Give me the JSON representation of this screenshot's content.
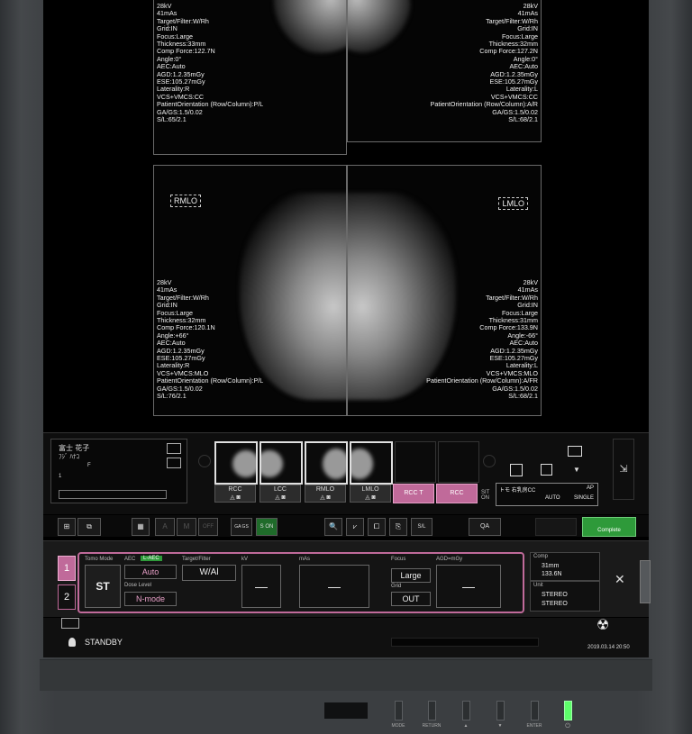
{
  "images": {
    "rcc_overlay": "28kV\n41mAs\nTarget/Filter:W/Rh\nGrid:IN\nFocus:Large\nThickness:33mm\nComp Force:122.7N\nAngle:0°\nAEC:Auto\nAGD:1.2.35mGy\nESE:105.27mGy\nLaterality:R\nVCS+VMCS:CC\nPatientOrientation (Row/Column):P/L\nGA/GS:1.5/0.02\nS/L:65/2.1",
    "lcc_overlay": "28kV\n41mAs\nTarget/Filter:W/Rh\nGrid:IN\nFocus:Large\nThickness:32mm\nComp Force:127.2N\nAngle:0°\nAEC:Auto\nAGD:1.2.35mGy\nESE:105.27mGy\nLaterality:L\nVCS+VMCS:CC\nPatientOrientation (Row/Column):A/R\nGA/GS:1.5/0.02\nS/L:68/2.1",
    "rmlo_overlay": "28kV\n41mAs\nTarget/Filter:W/Rh\nGrid:IN\nFocus:Large\nThickness:32mm\nComp Force:120.1N\nAngle:+66°\nAEC:Auto\nAGD:1.2.35mGy\nESE:105.27mGy\nLaterality:R\nVCS+VMCS:MLO\nPatientOrientation (Row/Column):P/L\nGA/GS:1.5/0.02\nS/L:76/2.1",
    "lmlo_overlay": "28kV\n41mAs\nTarget/Filter:W/Rh\nGrid:IN\nFocus:Large\nThickness:31mm\nComp Force:133.9N\nAngle:-66°\nAEC:Auto\nAGD:1.2.35mGy\nESE:105.27mGy\nLaterality:L\nVCS+VMCS:MLO\nPatientOrientation (Row/Column):A/FR\nGA/GS:1.5/0.02\nS/L:68/2.1",
    "rmlo_tag": "RMLO",
    "lmlo_tag": "LMLO"
  },
  "patient": {
    "name": "富士 花子",
    "kana": "ﾌｼﾞ ﾊﾅｺ",
    "sex": "F",
    "number": "1"
  },
  "thumbs": [
    {
      "label": "RCC"
    },
    {
      "label": "LCC"
    },
    {
      "label": "RMLO"
    },
    {
      "label": "LMLO"
    }
  ],
  "pending": [
    "RCC T",
    "RCC"
  ],
  "protocol": {
    "prefix": "SIT ON",
    "name": "トモ 右乳房CC",
    "mode": "AP",
    "aec": "AUTO",
    "shot": "SINGLE"
  },
  "toolbar": {
    "aec_off": "OFF",
    "ga_gs": "GA GS",
    "s_on": "S ON",
    "s_l": "S/L",
    "qa": "QA",
    "complete": "Complete"
  },
  "control": {
    "tab1": "1",
    "tab2": "2",
    "tomo_mode": "Tomo Mode",
    "st": "ST",
    "aec": "AEC",
    "aec_badge": "L-AEC",
    "aec_value": "Auto",
    "dose_level": "Dose Level",
    "dose_value": "N-mode",
    "target_filter": "Target/Filter",
    "target_value": "W/Al",
    "kv": "kV",
    "kv_value": "—",
    "mas": "mAs",
    "mas_value": "—",
    "focus": "Focus",
    "focus_value": "Large",
    "grid": "Grid",
    "grid_value": "OUT",
    "agd": "AGD=mGy",
    "agd_value": "—",
    "comp": "Comp",
    "comp_thick": "31mm",
    "comp_force": "133.6N",
    "unit": "Unit",
    "unit_1": "STEREO",
    "unit_2": "STEREO"
  },
  "status": {
    "state": "STANDBY",
    "datetime": "2019.03.14 20:50"
  },
  "physical": [
    "MODE",
    "RETURN",
    "▲",
    "▼",
    "ENTER",
    "⏻"
  ],
  "colors": {
    "accent_pink": "#c06a9a",
    "complete_green": "#2e9a3a",
    "power_led": "#5dff6a"
  }
}
